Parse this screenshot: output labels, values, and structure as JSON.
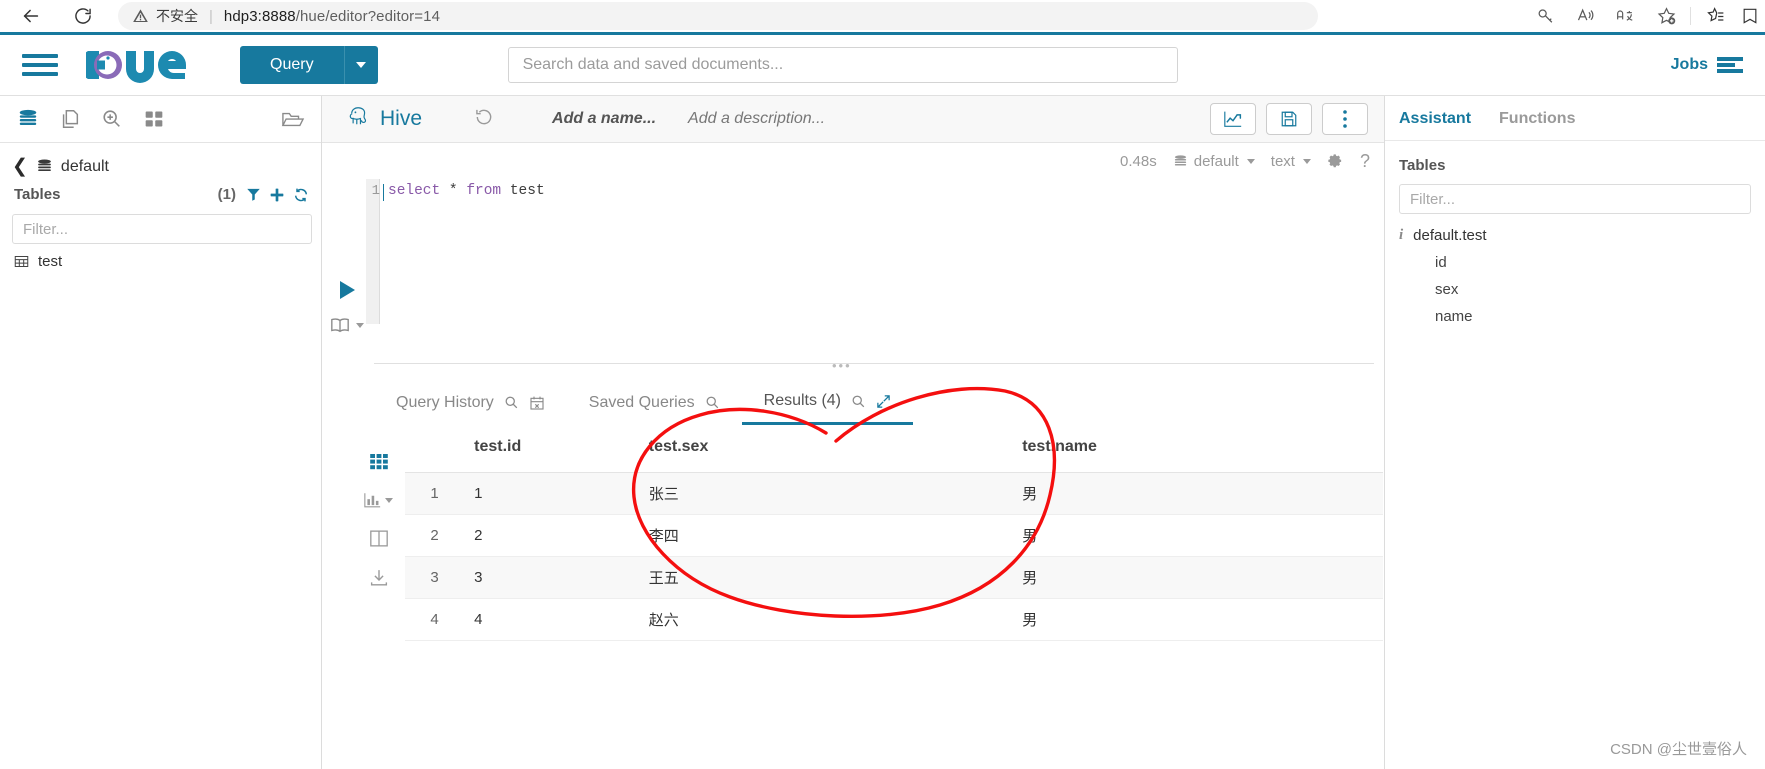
{
  "browser": {
    "back_label": "back-arrow",
    "reload_label": "reload",
    "security_warning": "不安全",
    "separator": "|",
    "url_host": "hdp3:8888",
    "url_path": "/hue/editor?editor=14",
    "url_full": "hdp3:8888/hue/editor?editor=14",
    "right_icons": [
      "key-icon",
      "read-aloud-icon",
      "translate-icon",
      "add-favorite-icon",
      "favorites-icon",
      "collections-icon"
    ]
  },
  "topnav": {
    "menu_label": "hamburger-menu",
    "logo_text": "hue",
    "query_button": "Query",
    "search_placeholder": "Search data and saved documents...",
    "search_value": "",
    "jobs_label": "Jobs",
    "accent_color": "#17799e"
  },
  "sidebar": {
    "icons": [
      "database-icon",
      "documents-icon",
      "search-plus-icon",
      "apps-grid-icon",
      "folder-open-icon"
    ],
    "breadcrumb_db": "default",
    "tables_label": "Tables",
    "tables_count": "(1)",
    "filter_placeholder": "Filter...",
    "filter_value": "",
    "tables": [
      {
        "name": "test"
      }
    ]
  },
  "editor": {
    "engine": "Hive",
    "name_placeholder": "Add a name...",
    "description_placeholder": "Add a description...",
    "buttons": [
      "chart-icon",
      "save-icon",
      "more-vertical-icon"
    ],
    "status": {
      "duration": "0.48s",
      "database": "default",
      "format": "text",
      "settings_icon": "gear-icon",
      "help_icon": "help-icon"
    },
    "code": {
      "line_number": "1",
      "keyword1": "select",
      "star": " * ",
      "keyword2": "from",
      "table": " test",
      "full_text": "select * from test"
    }
  },
  "results": {
    "tabs": [
      {
        "label": "Query History",
        "active": false,
        "icons": [
          "search-icon",
          "calendar-x-icon"
        ]
      },
      {
        "label": "Saved Queries",
        "active": false,
        "icons": [
          "search-icon"
        ]
      },
      {
        "label": "Results (4)",
        "active": true,
        "icons": [
          "search-icon",
          "expand-icon"
        ]
      }
    ],
    "side_icons": [
      "grid-view-icon",
      "chart-view-icon",
      "columns-view-icon",
      "download-icon"
    ],
    "columns": [
      "",
      "test.id",
      "test.sex",
      "test.name"
    ],
    "rows": [
      {
        "num": "1",
        "id": "1",
        "sex": "张三",
        "name": "男"
      },
      {
        "num": "2",
        "id": "2",
        "sex": "李四",
        "name": "男"
      },
      {
        "num": "3",
        "id": "3",
        "sex": "王五",
        "name": "男"
      },
      {
        "num": "4",
        "id": "4",
        "sex": "赵六",
        "name": "男"
      }
    ]
  },
  "assistant": {
    "tabs": [
      {
        "label": "Assistant",
        "active": true
      },
      {
        "label": "Functions",
        "active": false
      }
    ],
    "tables_label": "Tables",
    "filter_placeholder": "Filter...",
    "filter_value": "",
    "table_name": "default.test",
    "columns": [
      "id",
      "sex",
      "name"
    ]
  },
  "annotation": {
    "color": "#f40f0f",
    "shape": "hand-drawn-circle"
  },
  "watermark": "CSDN @尘世壹俗人"
}
